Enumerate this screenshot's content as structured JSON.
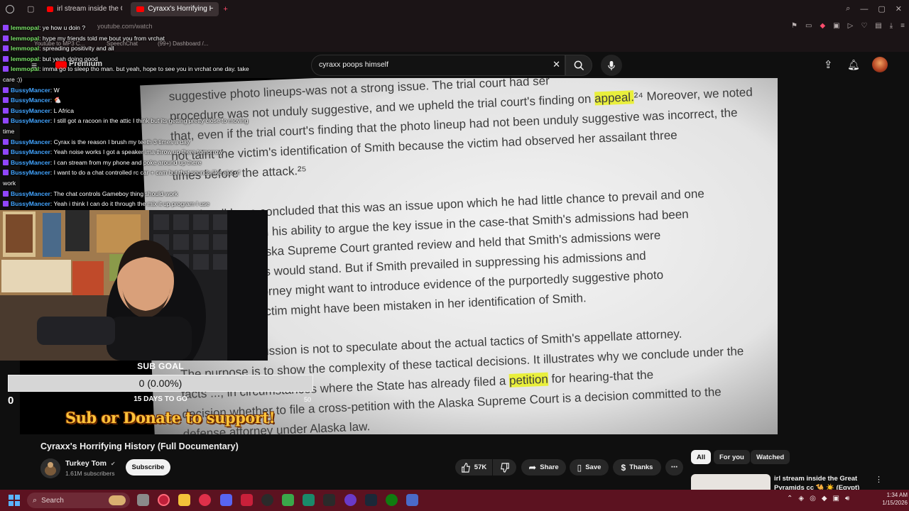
{
  "browser": {
    "tabs": [
      {
        "label": "irl stream inside the Great",
        "active": false
      },
      {
        "label": "Cyraxx's Horrifying H",
        "active": true
      }
    ],
    "url": "youtube.com/watch",
    "bookmarks": [
      "Youtube to MP3 C...",
      "SpeechChat",
      "(99+) Dashboard /..."
    ]
  },
  "youtube": {
    "logo_label": "Premium",
    "search_value": "cyraxx poops himself",
    "video": {
      "title": "Cyraxx's Horrifying History (Full Documentary)",
      "channel": "Turkey Tom",
      "subscribers": "1.61M subscribers",
      "subscribe_label": "Subscribe",
      "likes": "57K",
      "share_label": "Share",
      "save_label": "Save",
      "thanks_label": "Thanks"
    },
    "chips": [
      {
        "label": "All",
        "selected": true
      },
      {
        "label": "For you",
        "selected": false
      },
      {
        "label": "Watched",
        "selected": false
      }
    ],
    "recommendation": {
      "title": "irl stream inside the Great Pyramids cc 🐪 ☀️ (Egypt)"
    }
  },
  "document_lines": [
    {
      "segments": [
        {
          "text": "suggestive photo lineups-was not a strong issue.    The trial court had ser"
        }
      ]
    },
    {
      "segments": [
        {
          "text": "procedure was not unduly suggestive, and we upheld the trial court's finding on "
        },
        {
          "text": "appeal.",
          "hl": true
        },
        {
          "text": "²⁴   Moreover, we noted"
        }
      ]
    },
    {
      "segments": [
        {
          "text": "that, even if the trial court's finding that the photo lineup had not been unduly suggestive was incorrect, the"
        }
      ]
    },
    {
      "segments": [
        {
          "text": "not taint the victim's identification of Smith because the victim had observed her assailant three"
        }
      ]
    },
    {
      "segments": [
        {
          "text": "times before the attack.²⁵"
        }
      ]
    },
    {
      "segments": [
        {
          "text": ""
        }
      ]
    },
    {
      "segments": [
        {
          "text": "could well have concluded that this was an issue upon which he had little chance to prevail and one"
        }
      ]
    },
    {
      "segments": [
        {
          "text": "ve detracted from his ability to argue the key issue in the case-that Smith's admissions had been"
        }
      ]
    },
    {
      "segments": [
        {
          "text": "ressed.    If the Alaska Supreme Court granted review and held that Smith's admissions were"
        }
      ]
    },
    {
      "segments": [
        {
          "text": "mith's convictions would stand.    But if Smith prevailed in suppressing his admissions and"
        }
      ]
    },
    {
      "segments": [
        {
          "text": "w trial, a trial attorney might want to introduce evidence of the purportedly suggestive photo"
        }
      ]
    },
    {
      "segments": [
        {
          "text": "strate why the victim might have been mistaken in her identification of Smith."
        }
      ]
    },
    {
      "segments": [
        {
          "text": ""
        }
      ]
    },
    {
      "segments": [
        {
          "text": "of the prior discussion is not to speculate about the actual tactics of Smith's appellate attorney."
        }
      ]
    },
    {
      "segments": [
        {
          "text": "The purpose is to show the complexity of these tactical decisions.    It illustrates why we conclude under the"
        }
      ]
    },
    {
      "segments": [
        {
          "text": "facts ..., in circumstances where the State has already filed a "
        },
        {
          "text": "petition",
          "hl": true
        },
        {
          "text": " for hearing-that the"
        }
      ]
    },
    {
      "segments": [
        {
          "text": "decision whether to file a cross-petition with the Alaska Supreme Court is a decision committed to the"
        }
      ]
    },
    {
      "segments": [
        {
          "text": "defense attorney under Alaska law."
        }
      ]
    }
  ],
  "chat": [
    {
      "user": "lemmopal",
      "text": "ye how u doin ?",
      "color": "green"
    },
    {
      "user": "lemmopal",
      "text": "hype my friends told me bout you from vrchat",
      "color": "green"
    },
    {
      "user": "lemmopal",
      "text": "spreading positivity and all",
      "color": "green"
    },
    {
      "user": "lemmopal",
      "text": "but yeah doing good",
      "color": "green"
    },
    {
      "user": "lemmopal",
      "text": "imma go to sleep tho man. but yeah, hope to see you in vrchat one day. take care :))",
      "color": "green"
    },
    {
      "user": "BussyMancer",
      "text": "W",
      "color": "blue"
    },
    {
      "user": "BussyMancer",
      "text": "🐔",
      "color": "blue"
    },
    {
      "user": "BussyMancer",
      "text": "L Africa",
      "color": "blue"
    },
    {
      "user": "BussyMancer",
      "text": "I still got a racoon in the attic I think but its getting pretty close to moving time",
      "color": "blue"
    },
    {
      "user": "BussyMancer",
      "text": "Cyrax is the reason I brush my teeth 3 times a day",
      "color": "blue"
    },
    {
      "user": "BussyMancer",
      "text": "Yeah noise works I got a speaker ima throw up there tomorrow",
      "color": "blue"
    },
    {
      "user": "BussyMancer",
      "text": "I can stream from my phone and poke around up there",
      "color": "blue"
    },
    {
      "user": "BussyMancer",
      "text": "I want to do a chat controlled rc car + cam but that sounds like alot of work",
      "color": "blue"
    },
    {
      "user": "BussyMancer",
      "text": "The chat controls Gameboy thing should work",
      "color": "blue"
    },
    {
      "user": "BussyMancer",
      "text": "Yeah i think I can do it through the mix it up program I use",
      "color": "blue"
    }
  ],
  "sub_goal": {
    "title": "SUB GOAL",
    "value_text": "0 (0.00%)",
    "progress_fraction": 0,
    "days_text": "15 DAYS TO GO",
    "min_label": "0",
    "max_label": "50",
    "support_text": "Sub or Donate to support!"
  },
  "taskbar": {
    "search_placeholder": "Search",
    "time": "1:34 AM",
    "date": "1/15/2026"
  },
  "colors": {
    "youtube_red": "#ff0000",
    "taskbar": "#5c1220",
    "chat_green": "#7ce36a",
    "chat_blue": "#42a4ff",
    "highlight": "#e9ef3c",
    "support_text": "#ffc43a"
  }
}
